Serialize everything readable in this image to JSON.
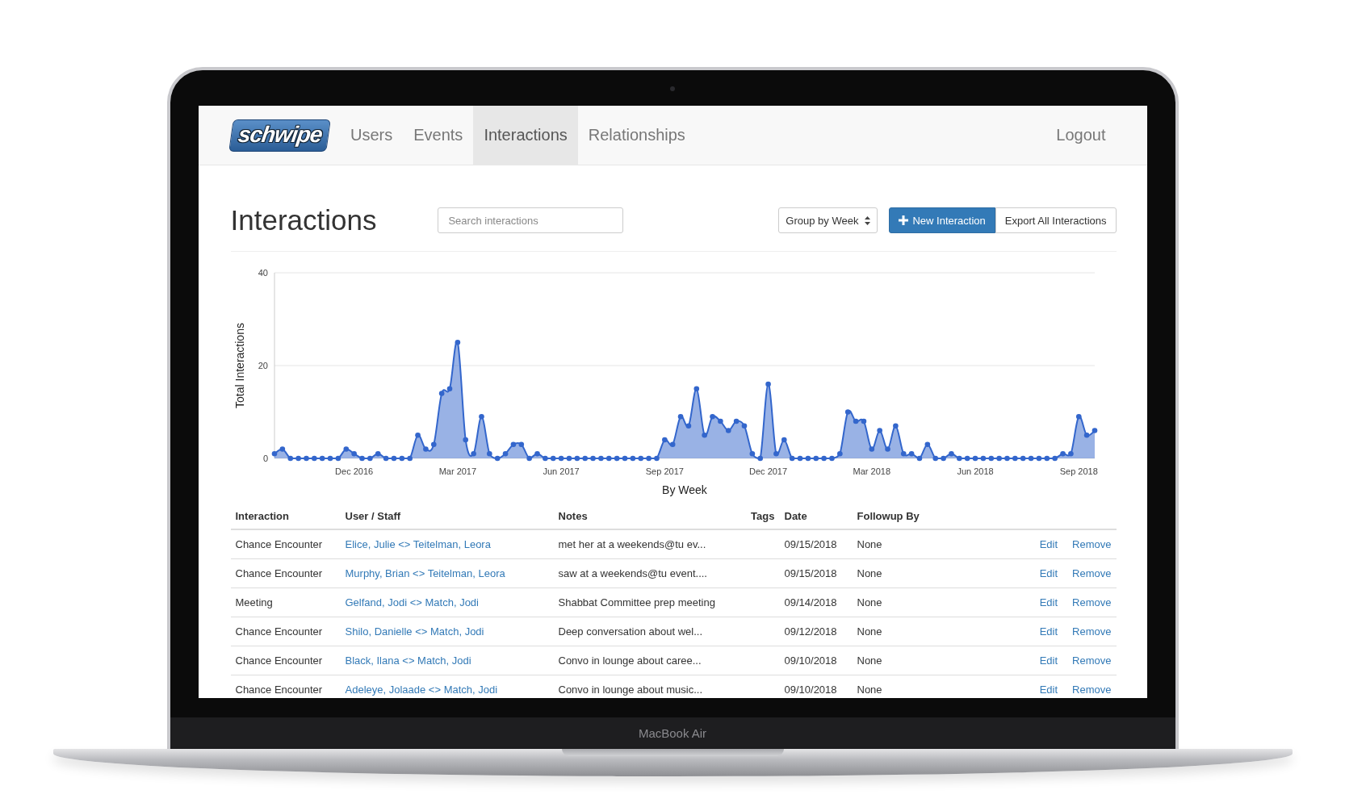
{
  "device": {
    "label": "MacBook Air"
  },
  "nav": {
    "logo": "schwipe",
    "items": [
      {
        "label": "Users",
        "selected": false
      },
      {
        "label": "Events",
        "selected": false
      },
      {
        "label": "Interactions",
        "selected": true
      },
      {
        "label": "Relationships",
        "selected": false
      }
    ],
    "logout": "Logout"
  },
  "page": {
    "title": "Interactions",
    "search": {
      "placeholder": "Search interactions"
    },
    "group_select": {
      "value": "Group by Week"
    },
    "buttons": [
      {
        "label": "New Interaction",
        "kind": "primary"
      },
      {
        "label": "Export All Interactions",
        "kind": "default"
      }
    ]
  },
  "chart": {
    "chart_data": {
      "type": "area",
      "xlabel": "By Week",
      "ylabel": "Total Interactions",
      "categories": [
        null,
        null,
        null,
        null,
        null,
        null,
        null,
        null,
        null,
        null,
        "Dec 2016",
        null,
        null,
        null,
        null,
        null,
        null,
        null,
        null,
        null,
        null,
        null,
        null,
        "Mar 2017",
        null,
        null,
        null,
        null,
        null,
        null,
        null,
        null,
        null,
        null,
        null,
        null,
        "Jun 2017",
        null,
        null,
        null,
        null,
        null,
        null,
        null,
        null,
        null,
        null,
        null,
        null,
        "Sep 2017",
        null,
        null,
        null,
        null,
        null,
        null,
        null,
        null,
        null,
        null,
        null,
        null,
        "Dec 2017",
        null,
        null,
        null,
        null,
        null,
        null,
        null,
        null,
        null,
        null,
        null,
        null,
        "Mar 2018",
        null,
        null,
        null,
        null,
        null,
        null,
        null,
        null,
        null,
        null,
        null,
        null,
        "Jun 2018",
        null,
        null,
        null,
        null,
        null,
        null,
        null,
        null,
        null,
        null,
        null,
        null,
        "Sep 2018",
        null,
        null
      ],
      "series": [
        {
          "color": "#3366cc",
          "values": [
            1,
            2,
            0,
            0,
            0,
            0,
            0,
            0,
            0,
            2,
            1,
            0,
            0,
            1,
            0,
            0,
            0,
            0,
            5,
            2,
            3,
            14,
            15,
            25,
            4,
            1,
            9,
            1,
            0,
            1,
            3,
            3,
            0,
            1,
            0,
            0,
            0,
            0,
            0,
            0,
            0,
            0,
            0,
            0,
            0,
            0,
            0,
            0,
            0,
            4,
            3,
            9,
            7,
            15,
            5,
            9,
            8,
            6,
            8,
            7,
            1,
            0,
            16,
            1,
            4,
            0,
            0,
            0,
            0,
            0,
            0,
            1,
            10,
            8,
            8,
            2,
            6,
            2,
            7,
            1,
            1,
            0,
            3,
            0,
            0,
            1,
            0,
            0,
            0,
            0,
            0,
            0,
            0,
            0,
            0,
            0,
            0,
            0,
            0,
            1,
            1,
            9,
            5,
            6
          ]
        }
      ],
      "ylim": [
        0,
        40
      ],
      "yticks": [
        0,
        20,
        40
      ]
    }
  },
  "table": {
    "columns": [
      "Interaction",
      "User / Staff",
      "Notes",
      "Tags",
      "Date",
      "Followup By"
    ],
    "rows": [
      {
        "interaction": "Chance Encounter",
        "participants": "Elice, Julie <> Teitelman, Leora",
        "notes": "met her at a weekends@tu ev...",
        "date": "09/15/2018",
        "followup": "None",
        "actions": [
          "Edit",
          "Remove"
        ]
      },
      {
        "interaction": "Chance Encounter",
        "participants": "Murphy, Brian <> Teitelman, Leora",
        "notes": "saw at a weekends@tu event....",
        "date": "09/15/2018",
        "followup": "None",
        "actions": [
          "Edit",
          "Remove"
        ]
      },
      {
        "interaction": "Meeting",
        "participants": "Gelfand, Jodi <> Match, Jodi",
        "notes": "Shabbat Committee prep meeting",
        "date": "09/14/2018",
        "followup": "None",
        "actions": [
          "Edit",
          "Remove"
        ]
      },
      {
        "interaction": "Chance Encounter",
        "participants": "Shilo, Danielle <> Match, Jodi",
        "notes": "Deep conversation about wel...",
        "date": "09/12/2018",
        "followup": "None",
        "actions": [
          "Edit",
          "Remove"
        ]
      },
      {
        "interaction": "Chance Encounter",
        "participants": "Black, Ilana <> Match, Jodi",
        "notes": "Convo in lounge about caree...",
        "date": "09/10/2018",
        "followup": "None",
        "actions": [
          "Edit",
          "Remove"
        ]
      },
      {
        "interaction": "Chance Encounter",
        "participants": "Adeleye, Jolaade <> Match, Jodi",
        "notes": "Convo in lounge about music...",
        "date": "09/10/2018",
        "followup": "None",
        "actions": [
          "Edit",
          "Remove"
        ]
      }
    ]
  }
}
